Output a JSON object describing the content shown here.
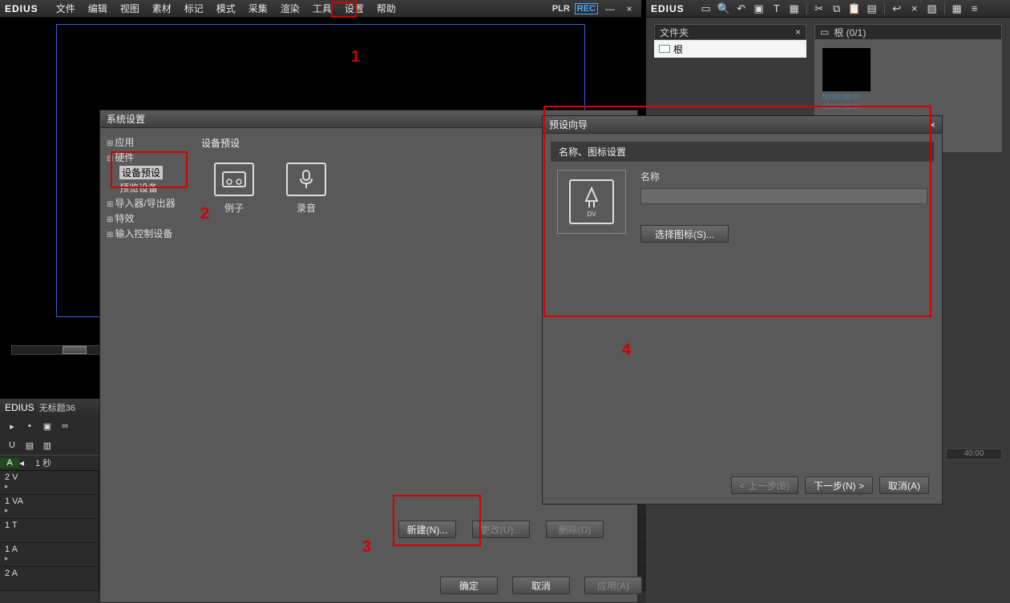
{
  "app": {
    "name": "EDIUS"
  },
  "menu": {
    "items": [
      "文件",
      "编辑",
      "视图",
      "素材",
      "标记",
      "模式",
      "采集",
      "渲染",
      "工具",
      "设置",
      "帮助"
    ]
  },
  "menu_right": {
    "plr": "PLR",
    "rec": "REC"
  },
  "right_panel": {
    "folder_title": "文件夹",
    "root_folder": "根",
    "clip_header_icon": "▭",
    "clip_header": "根 (0/1)",
    "tc1": "00:00:00:00",
    "tc2": "00:00:00:00"
  },
  "timeline": {
    "title": "EDIUS",
    "doc": "无标题36",
    "ruler_badge": "A",
    "sec_label": "1 秒",
    "tracks": [
      "2 V",
      "1 VA",
      "1 T",
      "1 A",
      "2 A"
    ],
    "scale_label": "40:00"
  },
  "sys_dialog": {
    "title": "系统设置",
    "tree": {
      "app": "应用",
      "hardware": "硬件",
      "device_preset": "设备预设",
      "preview_device": "预览设备",
      "importer_exporter": "导入器/导出器",
      "effects": "特效",
      "input_control": "输入控制设备"
    },
    "section_title": "设备预设",
    "tile1": "例子",
    "tile2": "录音",
    "btn_new": "新建(N)...",
    "btn_modify": "更改(U)...",
    "btn_delete": "删除(D)",
    "btn_ok": "确定",
    "btn_cancel": "取消",
    "btn_apply": "应用(A)"
  },
  "wizard": {
    "title": "预设向导",
    "section": "名称、图标设置",
    "name_label": "名称",
    "select_icon": "选择图标(S)...",
    "icon_sub": "DV",
    "prev": "< 上一步(B)",
    "next": "下一步(N) >",
    "cancel": "取消(A)"
  },
  "annotations": {
    "n1": "1",
    "n2": "2",
    "n3": "3",
    "n4": "4"
  }
}
